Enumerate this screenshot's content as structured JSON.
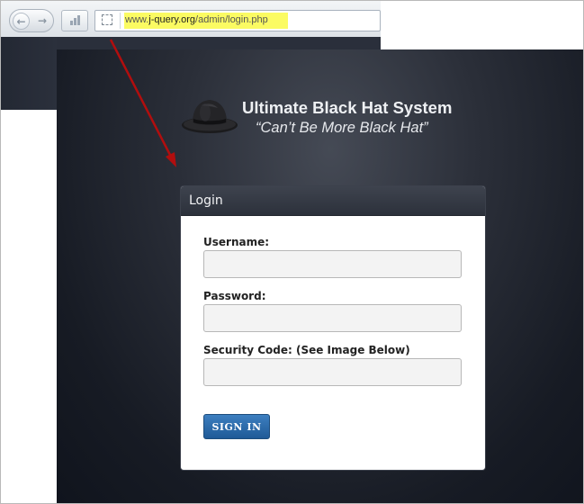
{
  "browser": {
    "nav": {
      "back_icon": "arrow-left-icon",
      "forward_icon": "arrow-right-icon"
    },
    "url_prefix": "www.",
    "url_domain": "j-query.org",
    "url_path": "/admin/login.php",
    "highlight_color": "#fbfb62"
  },
  "brand": {
    "title": "Ultimate Black Hat System",
    "tagline": "“Can’t Be More Black Hat”",
    "logo_icon": "black-hat-icon"
  },
  "login": {
    "title": "Login",
    "fields": [
      {
        "label": "Username:",
        "value": "",
        "placeholder": ""
      },
      {
        "label": "Password:",
        "value": "",
        "placeholder": ""
      },
      {
        "label": "Security Code: (See Image Below)",
        "value": "",
        "placeholder": ""
      }
    ],
    "submit_label": "SIGN IN",
    "accent_color": "#2a6aab"
  },
  "annotation": {
    "arrow_color": "#b10e0e"
  }
}
